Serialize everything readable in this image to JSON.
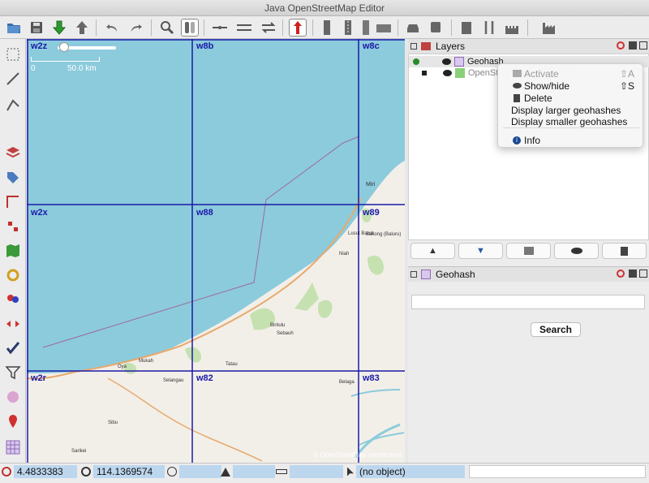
{
  "window": {
    "title": "Java OpenStreetMap Editor"
  },
  "map": {
    "cells": [
      {
        "label": "w2z"
      },
      {
        "label": "w8b"
      },
      {
        "label": "w8c"
      },
      {
        "label": "w2x"
      },
      {
        "label": "w88"
      },
      {
        "label": "w89"
      },
      {
        "label": "w2r"
      },
      {
        "label": "w82"
      },
      {
        "label": "w83"
      }
    ],
    "scale": {
      "zero": "0",
      "distance": "50.0 km"
    },
    "attribution": "© OpenStreetMap contributors",
    "places": [
      "Miri",
      "Bakong (Baluru)",
      "Niah",
      "Bintulu",
      "Sebauh",
      "Mukah",
      "Oya",
      "Tatau",
      "Selangau",
      "Sibu",
      "Sarikei",
      "Belaga",
      "Lusut Baruk"
    ],
    "colors": {
      "sea": "#8ccbdc",
      "land": "#f2efe9",
      "forest": "#c5e1b0",
      "grid": "#1a1aa8",
      "road": "#e8a96a"
    }
  },
  "layers_panel": {
    "title": "Layers",
    "layers": [
      {
        "name": "Geohash",
        "active": true
      },
      {
        "name": "OpenStreetMap (Standard)",
        "active": false
      }
    ]
  },
  "context_menu": {
    "items": [
      {
        "label": "Activate",
        "shortcut": "⇧A",
        "icon": "activate-icon",
        "enabled": false
      },
      {
        "label": "Show/hide",
        "shortcut": "⇧S",
        "icon": "eye-slash-icon",
        "enabled": true
      },
      {
        "label": "Delete",
        "shortcut": "",
        "icon": "trash-icon",
        "enabled": true
      },
      {
        "label": "Display larger geohashes",
        "shortcut": "",
        "icon": "",
        "enabled": true
      },
      {
        "label": "Display smaller geohashes",
        "shortcut": "",
        "icon": "",
        "enabled": true
      },
      {
        "label": "Info",
        "shortcut": "",
        "icon": "info-icon",
        "enabled": true
      }
    ]
  },
  "geohash_panel": {
    "title": "Geohash",
    "search_value": "",
    "search_label": "Search"
  },
  "status": {
    "lat": "4.4833383",
    "lon": "114.1369574",
    "heading": "",
    "angle": "",
    "distance": "",
    "object": "(no object)"
  }
}
